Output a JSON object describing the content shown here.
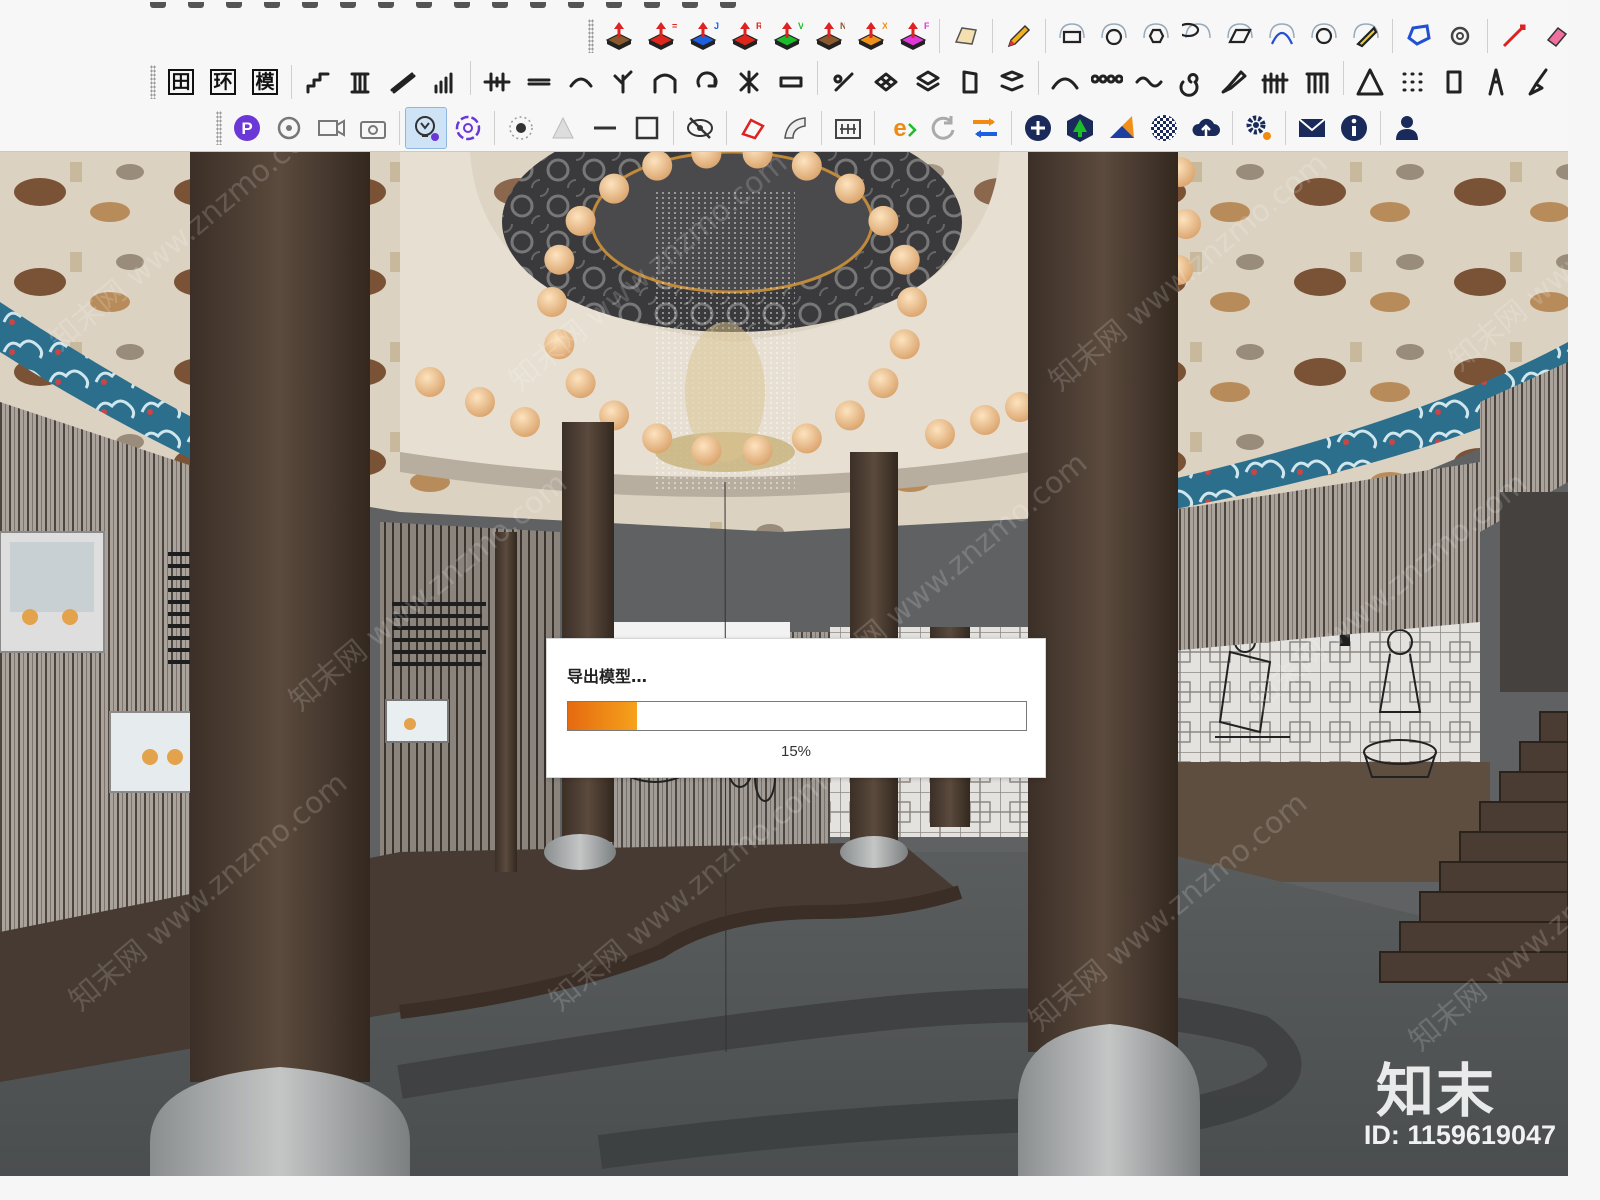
{
  "toolbar_row1": {
    "arrow_letters": [
      "",
      "=",
      "J",
      "R",
      "V",
      "N",
      "X",
      "F"
    ],
    "colors": {
      "red": "#e0261c",
      "blue": "#1c5fe0",
      "green": "#1cbd2a",
      "orange": "#f0901a",
      "magenta": "#e038d8",
      "brown": "#8a5a2c"
    }
  },
  "toolbar_row2": {
    "buttons": [
      {
        "name": "grid-view-button",
        "label": "田"
      },
      {
        "name": "environment-button",
        "label": "环"
      },
      {
        "name": "model-button",
        "label": "模"
      }
    ]
  },
  "toolbar_row3": {
    "active_tool": "light-tool-button",
    "brand_icon_color": "#6b37d6"
  },
  "dialog": {
    "title": "导出模型…",
    "progress_value": 0.15,
    "progress_text": "15%",
    "fill_color_start": "#e56a10",
    "fill_color_end": "#f6a21c"
  },
  "watermark": {
    "logo_text": "知末",
    "id_text": "ID: 1159619047",
    "tile_text": "知末网 www.znzmo.com"
  }
}
